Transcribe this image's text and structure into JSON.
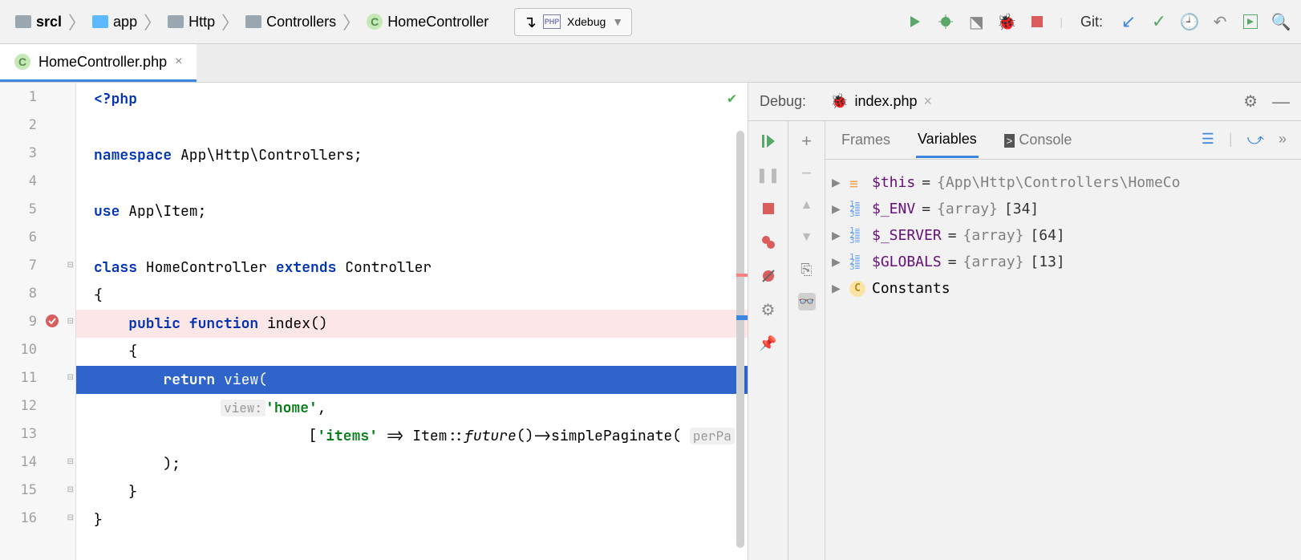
{
  "breadcrumb": [
    {
      "label": "srcl",
      "icon": "folder",
      "bold": true
    },
    {
      "label": "app",
      "icon": "folder-blue"
    },
    {
      "label": "Http",
      "icon": "folder"
    },
    {
      "label": "Controllers",
      "icon": "folder"
    },
    {
      "label": "HomeController",
      "icon": "class"
    }
  ],
  "runConfig": {
    "label": "Xdebug"
  },
  "git": {
    "label": "Git:"
  },
  "tab": {
    "file": "HomeController.php"
  },
  "lines": {
    "l1": "<?php",
    "l3a": "namespace",
    "l3b": " App\\Http\\Controllers;",
    "l5a": "use",
    "l5b": " App\\Item;",
    "l7a": "class",
    "l7b": " HomeController ",
    "l7c": "extends",
    "l7d": " Controller",
    "l8": "{",
    "l9a": "    public function",
    "l9b": " index()",
    "l10": "    {",
    "l11a": "        return ",
    "l11b": "view(",
    "l12hint": "view:",
    "l12str": "'home'",
    "l12end": ",",
    "l13a": "            [",
    "l13str": "'items'",
    "l13b": " => Item::",
    "l13func": "future",
    "l13c": "()->simplePaginate( ",
    "l13hint": "perPa",
    "l14": "        );",
    "l15": "    }",
    "l16": "}"
  },
  "lineNumbers": [
    "1",
    "2",
    "3",
    "4",
    "5",
    "6",
    "7",
    "8",
    "9",
    "10",
    "11",
    "12",
    "13",
    "14",
    "15",
    "16"
  ],
  "debug": {
    "title": "Debug:",
    "session": "index.php",
    "tabs": {
      "frames": "Frames",
      "variables": "Variables",
      "console": "Console"
    },
    "vars": [
      {
        "name": "$this",
        "eq": " = ",
        "type": "{App\\Http\\Controllers\\HomeCo",
        "icon": "field"
      },
      {
        "name": "$_ENV",
        "eq": " = ",
        "type": "{array} ",
        "num": "[34]",
        "icon": "array"
      },
      {
        "name": "$_SERVER",
        "eq": " = ",
        "type": "{array} ",
        "num": "[64]",
        "icon": "array"
      },
      {
        "name": "$GLOBALS",
        "eq": " = ",
        "type": "{array} ",
        "num": "[13]",
        "icon": "array"
      },
      {
        "name": "Constants",
        "icon": "const"
      }
    ]
  }
}
